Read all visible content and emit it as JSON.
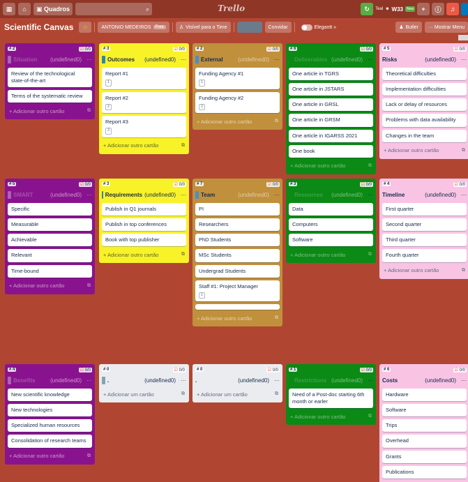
{
  "topbar": {
    "boards_label": "Quadros",
    "search_icon": "search-icon",
    "logo": "Trello",
    "tiny_text": "Teal",
    "w33": "W33",
    "new_badge": "New"
  },
  "header": {
    "title": "Scientific Canvas",
    "workspace": "ANTONIO MEDEIROS",
    "free_badge": "Free",
    "visibility": "Visível para o Time",
    "invite": "Convidar",
    "elegantt": "Elegantt »",
    "butler": "Butler",
    "menu": "··· Mostrar Menu"
  },
  "lists": [
    {
      "id": "purple-1",
      "num": "# 2",
      "count": "0/0",
      "title": "Situation",
      "sub": "(undefined0)",
      "cards": [
        {
          "text": "Review of the technological state-of-the-art"
        },
        {
          "text": "Terms of the systematic review"
        }
      ],
      "add": "+ Adicionar outro cartão"
    },
    {
      "id": "yellow-1",
      "num": "# 3",
      "count": "0/0",
      "title": "Outcomes",
      "sub": "(undefined0)",
      "cards": [
        {
          "text": "Report #1",
          "badge": "1"
        },
        {
          "text": "Report #2",
          "badge": "2"
        },
        {
          "text": "Report #3",
          "badge": "3"
        }
      ],
      "add": "+ Adicionar outro cartão"
    },
    {
      "id": "gold-1",
      "num": "# 2",
      "count": "0/0",
      "title": "External",
      "sub": "(undefined0)",
      "cards": [
        {
          "text": "Funding Agency #1",
          "badge": "1"
        },
        {
          "text": "Funding Agency #2",
          "badge": "2"
        }
      ],
      "add": "+ Adicionar outro cartão"
    },
    {
      "id": "green-1",
      "num": "# 6",
      "count": "0/0",
      "title": "Deliverables",
      "sub": "(undefined0)",
      "cards": [
        {
          "text": "One article in TGRS"
        },
        {
          "text": "One article in JSTARS"
        },
        {
          "text": "One article in GRSL"
        },
        {
          "text": "One article in GRSM"
        },
        {
          "text": "One article in IGARSS 2021"
        },
        {
          "text": "One book"
        }
      ],
      "add": "+ Adicionar outro cartão"
    },
    {
      "id": "pink-1",
      "num": "# 5",
      "count": "0/0",
      "title": "Risks",
      "sub": "(undefined0)",
      "cards": [
        {
          "text": "Theoretical difficulties"
        },
        {
          "text": "Implementation difficulties"
        },
        {
          "text": "Lack or delay of resources"
        },
        {
          "text": "Problems with data availability"
        },
        {
          "text": "Changes in the team"
        }
      ],
      "add": "+ Adicionar outro cartão"
    },
    {
      "id": "purple-2",
      "num": "# 5",
      "count": "0/0",
      "title": "SMART",
      "sub": "(undefined0)",
      "cards": [
        {
          "text": "Specific"
        },
        {
          "text": "Measurable"
        },
        {
          "text": "Achievable"
        },
        {
          "text": "Relevant"
        },
        {
          "text": "Time-bound"
        }
      ],
      "add": "+ Adicionar outro cartão"
    },
    {
      "id": "yellow-2",
      "num": "# 3",
      "count": "0/0",
      "title": "Requirements",
      "sub": "(undefined0)",
      "cards": [
        {
          "text": "Publish in Q1 journals"
        },
        {
          "text": "Publish in top conferences"
        },
        {
          "text": "Book with top publisher"
        }
      ],
      "add": "+ Adicionar outro cartão"
    },
    {
      "id": "gold-2",
      "num": "# 7",
      "count": "0/0",
      "title": "Team",
      "sub": "(undefined0)",
      "cards": [
        {
          "text": "PI"
        },
        {
          "text": "Researchers"
        },
        {
          "text": "PhD Students"
        },
        {
          "text": "MSc Students"
        },
        {
          "text": "Undergrad Students"
        },
        {
          "text": "Staff #1: Project Manager",
          "badge": "1"
        },
        {
          "text": ""
        }
      ],
      "add": "+ Adicionar outro cartão"
    },
    {
      "id": "green-2",
      "num": "# 3",
      "count": "0/0",
      "title": "Resources",
      "sub": "(undefined0)",
      "cards": [
        {
          "text": "Data"
        },
        {
          "text": "Computers"
        },
        {
          "text": "Software"
        }
      ],
      "add": "+ Adicionar outro cartão"
    },
    {
      "id": "pink-2",
      "num": "# 4",
      "count": "0/0",
      "title": "Timeline",
      "sub": "(undefined0)",
      "cards": [
        {
          "text": "First quarter"
        },
        {
          "text": "Second quarter"
        },
        {
          "text": "Third quarter"
        },
        {
          "text": "Fourth quarter"
        }
      ],
      "add": "+ Adicionar outro cartão"
    },
    {
      "id": "purple-3",
      "num": "# 4",
      "count": "0/0",
      "title": "Benefits",
      "sub": "(undefined0)",
      "cards": [
        {
          "text": "New scientific knowledge"
        },
        {
          "text": "New technologies"
        },
        {
          "text": "Specialized human resources"
        },
        {
          "text": "Consolidation of research teams"
        }
      ],
      "add": "+ Adicionar outro cartão"
    },
    {
      "id": "gray-1",
      "num": "# 0",
      "count": "0/0",
      "title": ".",
      "sub": "(undefined0)",
      "cards": [],
      "add": "+ Adicionar um cartão"
    },
    {
      "id": "gray-2",
      "num": "# 0",
      "count": "0/0",
      "title": ".",
      "sub": "(undefined0)",
      "cards": [],
      "add": "+ Adicionar um cartão"
    },
    {
      "id": "green-3",
      "num": "# 1",
      "count": "0/0",
      "title": "Restrictions",
      "sub": "(undefined0)",
      "cards": [
        {
          "text": "Need of a Post-doc starting 6th month or earler"
        }
      ],
      "add": "+ Adicionar outro cartão"
    },
    {
      "id": "pink-3",
      "num": "# 6",
      "count": "0/0",
      "title": "Costs",
      "sub": "(undefined0)",
      "cards": [
        {
          "text": "Hardware"
        },
        {
          "text": "Software"
        },
        {
          "text": "Trips"
        },
        {
          "text": "Overhead"
        },
        {
          "text": "Grants"
        },
        {
          "text": "Publications"
        }
      ],
      "add": "+ Adicionar outro cartão"
    }
  ]
}
